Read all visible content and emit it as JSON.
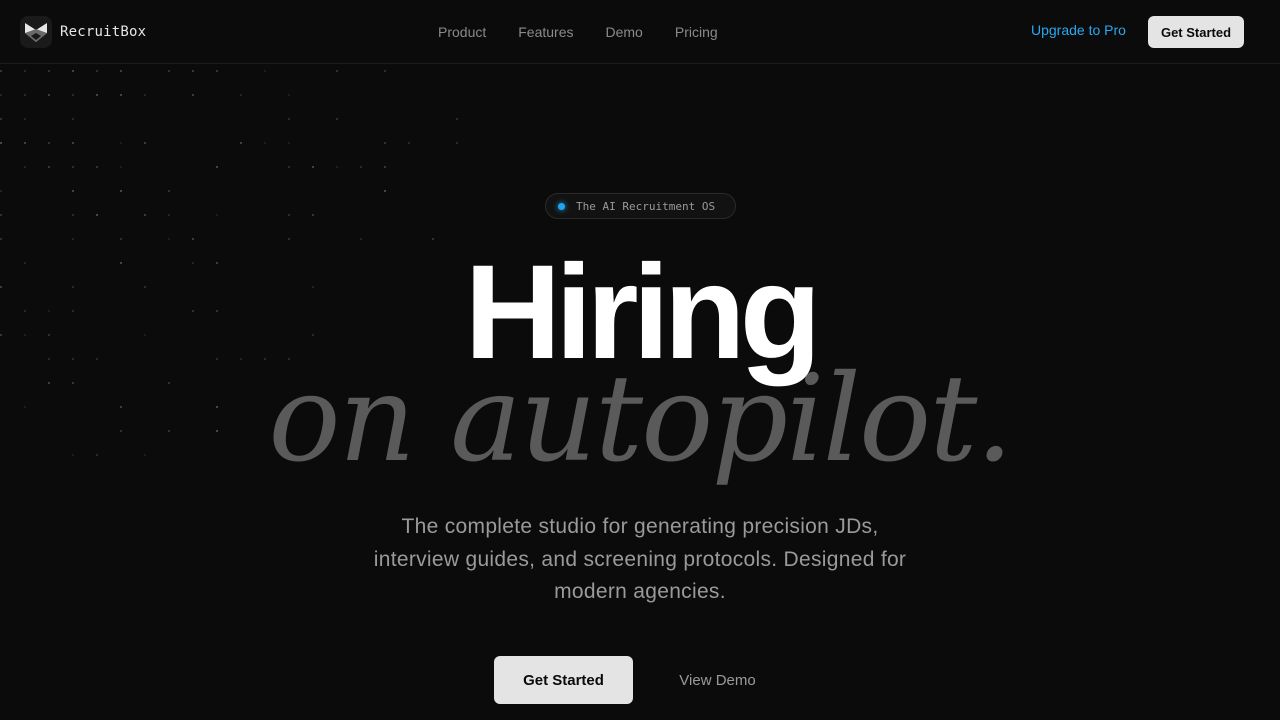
{
  "brand": {
    "name": "RecruitBox",
    "logo_icon": "fox-mask-icon"
  },
  "nav": {
    "links": [
      "Product",
      "Features",
      "Demo",
      "Pricing"
    ],
    "upgrade_label": "Upgrade to Pro",
    "cta_label": "Get Started"
  },
  "hero": {
    "badge_text": "The AI Recruitment OS",
    "title_line1": "Hiring",
    "title_line2": "on autopilot.",
    "subtitle": "The complete studio for generating precision JDs, interview guides, and screening protocols. Designed for modern agencies.",
    "primary_cta": "Get Started",
    "secondary_cta": "View Demo"
  },
  "colors": {
    "background": "#0b0b0b",
    "accent_blue": "#1fa6ee",
    "button_light": "#e4e4e4",
    "muted_text": "#9a9a9a"
  }
}
